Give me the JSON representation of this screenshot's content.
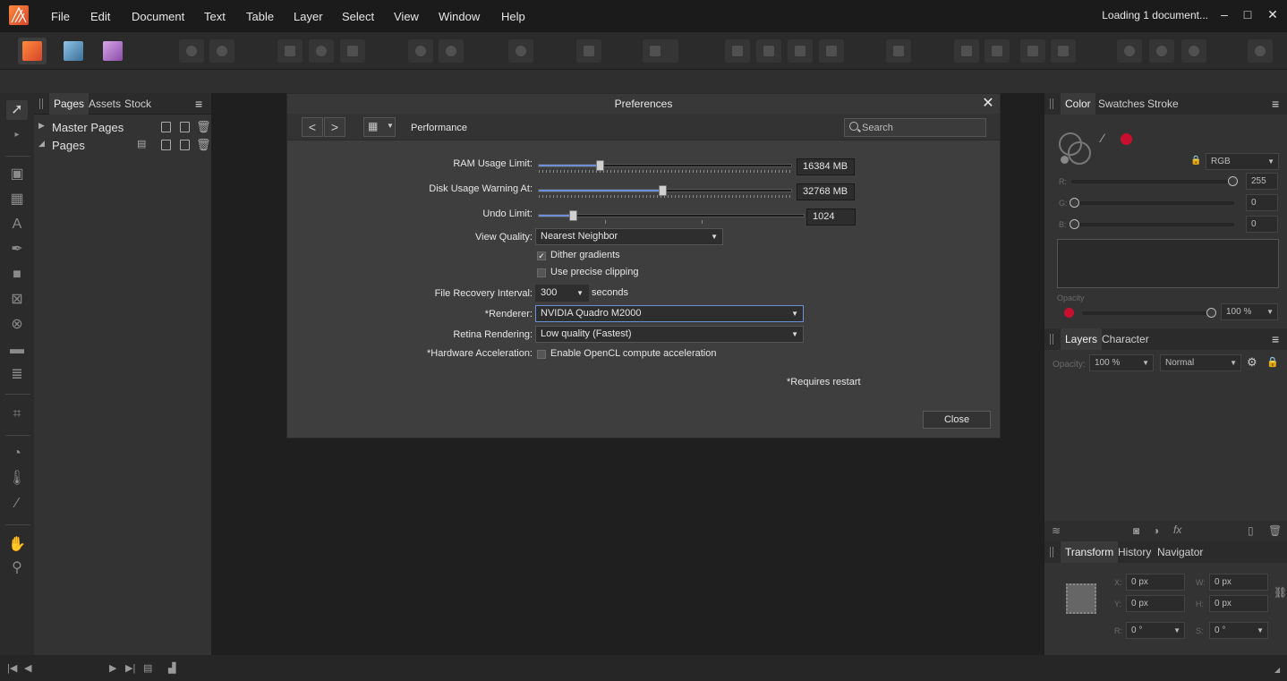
{
  "menu": [
    "File",
    "Edit",
    "Document",
    "Text",
    "Table",
    "Layer",
    "Select",
    "View",
    "Window",
    "Help"
  ],
  "status": "Loading 1 document...",
  "window_controls": [
    "–",
    "□",
    "✕"
  ],
  "left_panel": {
    "tabs": [
      "Pages",
      "Assets",
      "Stock"
    ],
    "tree": [
      {
        "label": "Master Pages",
        "expanded": false
      },
      {
        "label": "Pages",
        "expanded": true
      }
    ]
  },
  "dialog": {
    "title": "Preferences",
    "section": "Performance",
    "search_placeholder": "Search",
    "ram_label": "RAM Usage Limit:",
    "ram_value": "16384 MB",
    "ram_fraction": 0.24,
    "disk_label": "Disk Usage Warning At:",
    "disk_value": "32768 MB",
    "disk_fraction": 0.49,
    "undo_label": "Undo Limit:",
    "undo_value": "1024",
    "undo_fraction": 0.13,
    "view_quality_label": "View Quality:",
    "view_quality": "Nearest Neighbor",
    "dither_label": "Dither gradients",
    "dither_checked": true,
    "precise_label": "Use precise clipping",
    "precise_checked": false,
    "recovery_label": "File Recovery Interval:",
    "recovery_value": "300",
    "recovery_unit": "seconds",
    "renderer_label": "*Renderer:",
    "renderer": "NVIDIA Quadro M2000",
    "retina_label": "Retina Rendering:",
    "retina": "Low quality (Fastest)",
    "hw_label": "*Hardware Acceleration:",
    "opencl_label": "Enable OpenCL compute acceleration",
    "opencl_checked": false,
    "restart_note": "*Requires restart",
    "close_label": "Close"
  },
  "color_panel": {
    "tabs": [
      "Color",
      "Swatches",
      "Stroke"
    ],
    "model": "RGB",
    "r_label": "R:",
    "r": "255",
    "g_label": "G:",
    "g": "0",
    "b_label": "B:",
    "b": "0",
    "opacity_label": "Opacity",
    "opacity": "100 %",
    "swatch_color": "#c8102e"
  },
  "layers_panel": {
    "tabs": [
      "Layers",
      "Character"
    ],
    "opacity_label": "Opacity:",
    "opacity": "100 %",
    "blend": "Normal"
  },
  "transform_panel": {
    "tabs": [
      "Transform",
      "History",
      "Navigator"
    ],
    "x_label": "X:",
    "x": "0 px",
    "y_label": "Y:",
    "y": "0 px",
    "w_label": "W:",
    "w": "0 px",
    "h_label": "H:",
    "h": "0 px",
    "r_label": "R:",
    "r": "0 °",
    "s_label": "S:",
    "s": "0 °"
  }
}
